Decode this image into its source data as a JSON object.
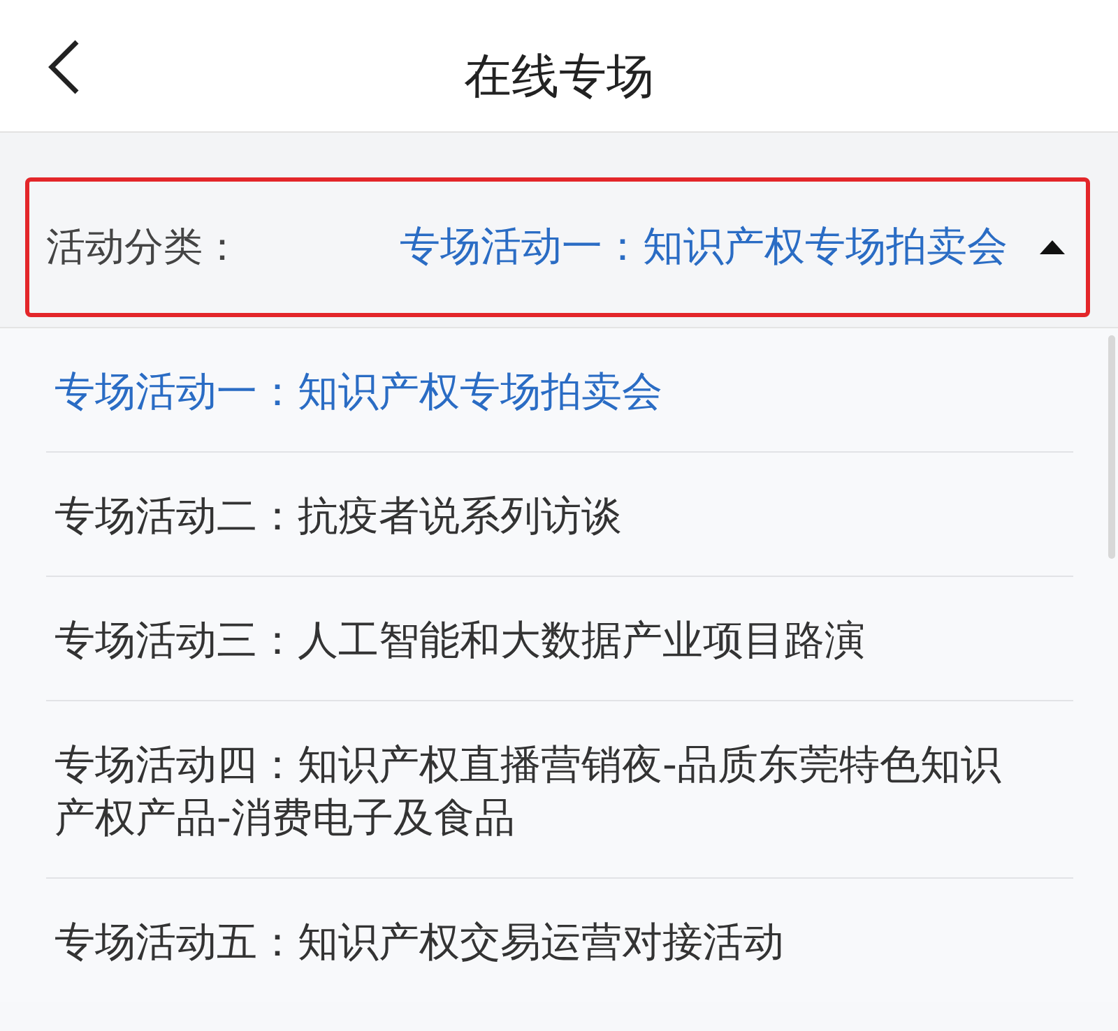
{
  "header": {
    "title": "在线专场"
  },
  "filter": {
    "label": "活动分类：",
    "value": "专场活动一：知识产权专场拍卖会",
    "expanded": true
  },
  "options": [
    {
      "label": "专场活动一：知识产权专场拍卖会",
      "selected": true
    },
    {
      "label": "专场活动二：抗疫者说系列访谈",
      "selected": false
    },
    {
      "label": "专场活动三：人工智能和大数据产业项目路演",
      "selected": false
    },
    {
      "label": "专场活动四：知识产权直播营销夜-品质东莞特色知识产权产品-消费电子及食品",
      "selected": false
    },
    {
      "label": "专场活动五：知识产权交易运营对接活动",
      "selected": false
    }
  ]
}
